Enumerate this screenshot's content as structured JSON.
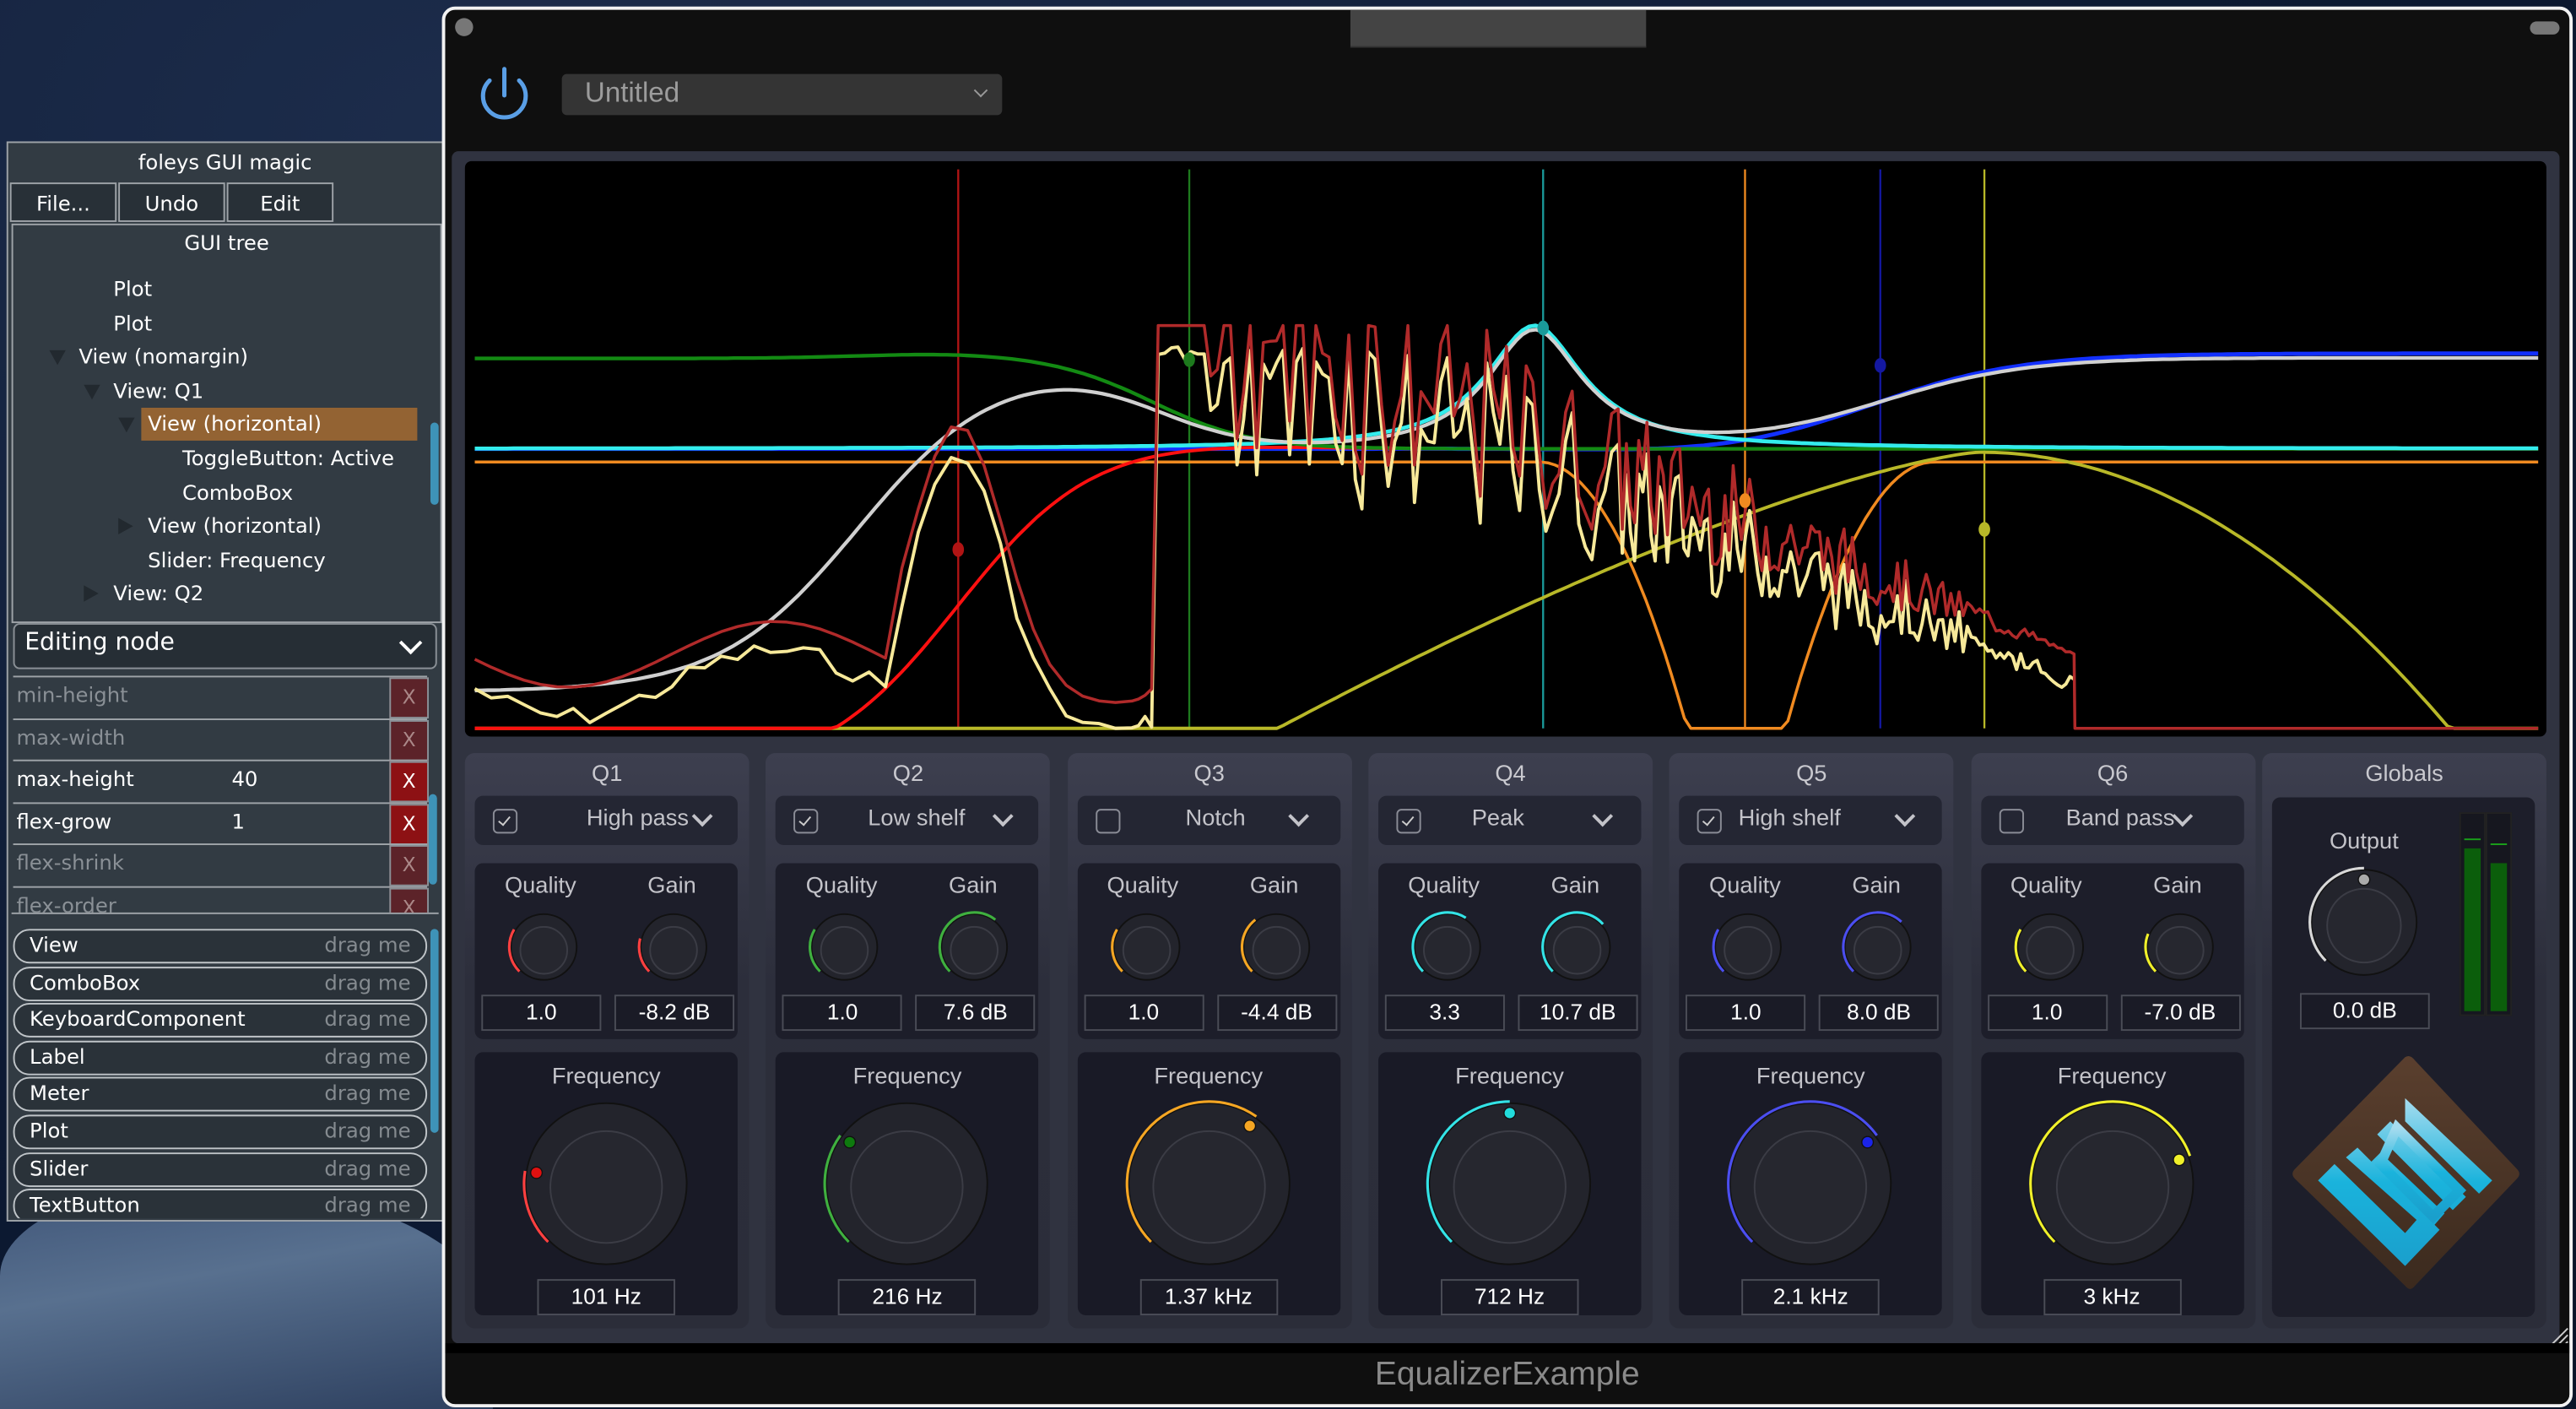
{
  "editor": {
    "title": "foleys GUI magic",
    "menu": [
      "File...",
      "Undo",
      "Edit"
    ],
    "tree_title": "GUI tree",
    "tree": [
      {
        "label": "Plot",
        "depth": 3,
        "toggle": "none"
      },
      {
        "label": "Plot",
        "depth": 3,
        "toggle": "none"
      },
      {
        "label": "View (nomargin)",
        "depth": 2,
        "toggle": "down"
      },
      {
        "label": "View: Q1",
        "depth": 3,
        "toggle": "down"
      },
      {
        "label": "View (horizontal)",
        "depth": 4,
        "toggle": "down",
        "selected": true
      },
      {
        "label": "ToggleButton: Active",
        "depth": 5,
        "toggle": "none"
      },
      {
        "label": "ComboBox",
        "depth": 5,
        "toggle": "none"
      },
      {
        "label": "View (horizontal)",
        "depth": 4,
        "toggle": "right"
      },
      {
        "label": "Slider: Frequency",
        "depth": 4,
        "toggle": "none"
      },
      {
        "label": "View: Q2",
        "depth": 3,
        "toggle": "right"
      }
    ],
    "properties_header": "Editing node",
    "properties": [
      {
        "name": "min-height",
        "value": "",
        "set": false
      },
      {
        "name": "max-width",
        "value": "",
        "set": false
      },
      {
        "name": "max-height",
        "value": "40",
        "set": true
      },
      {
        "name": "flex-grow",
        "value": "1",
        "set": true
      },
      {
        "name": "flex-shrink",
        "value": "",
        "set": false
      },
      {
        "name": "flex-order",
        "value": "",
        "set": false
      }
    ],
    "remove_label": "X",
    "palette": [
      {
        "name": "View",
        "hint": "drag me"
      },
      {
        "name": "ComboBox",
        "hint": "drag me"
      },
      {
        "name": "KeyboardComponent",
        "hint": "drag me"
      },
      {
        "name": "Label",
        "hint": "drag me"
      },
      {
        "name": "Meter",
        "hint": "drag me"
      },
      {
        "name": "Plot",
        "hint": "drag me"
      },
      {
        "name": "Slider",
        "hint": "drag me"
      },
      {
        "name": "TextButton",
        "hint": "drag me"
      }
    ]
  },
  "plugin": {
    "preset": "Untitled",
    "power_on": true,
    "footer": "EqualizerExample",
    "power_color": "#5a9fe6",
    "bands": [
      {
        "title": "Q1",
        "active": true,
        "type": "High pass",
        "quality_label": "Quality",
        "gain_label": "Gain",
        "quality": "1.0",
        "gain": "-8.2 dB",
        "frequency_label": "Frequency",
        "frequency": "101 Hz",
        "color": "#ff4040",
        "dot": "#e01010",
        "q_frac": 0.28,
        "g_frac": 0.22,
        "f_frac": 0.2
      },
      {
        "title": "Q2",
        "active": true,
        "type": "Low shelf",
        "quality_label": "Quality",
        "gain_label": "Gain",
        "quality": "1.0",
        "gain": "7.6 dB",
        "frequency_label": "Frequency",
        "frequency": "216 Hz",
        "color": "#3fb03f",
        "dot": "#0e7a0e",
        "q_frac": 0.28,
        "g_frac": 0.64,
        "f_frac": 0.3
      },
      {
        "title": "Q3",
        "active": false,
        "type": "Notch",
        "quality_label": "Quality",
        "gain_label": "Gain",
        "quality": "1.0",
        "gain": "-4.4 dB",
        "frequency_label": "Frequency",
        "frequency": "1.37 kHz",
        "color": "#f5a623",
        "dot": "#f5a623",
        "q_frac": 0.28,
        "g_frac": 0.36,
        "f_frac": 0.63
      },
      {
        "title": "Q4",
        "active": true,
        "type": "Peak",
        "quality_label": "Quality",
        "gain_label": "Gain",
        "quality": "3.3",
        "gain": "10.7 dB",
        "frequency_label": "Frequency",
        "frequency": "712 Hz",
        "color": "#33e3e6",
        "dot": "#22dcdc",
        "q_frac": 0.62,
        "g_frac": 0.68,
        "f_frac": 0.5
      },
      {
        "title": "Q5",
        "active": true,
        "type": "High shelf",
        "quality_label": "Quality",
        "gain_label": "Gain",
        "quality": "1.0",
        "gain": "8.0 dB",
        "frequency_label": "Frequency",
        "frequency": "2.1 kHz",
        "color": "#4b4ef0",
        "dot": "#1b24e8",
        "q_frac": 0.28,
        "g_frac": 0.66,
        "f_frac": 0.7
      },
      {
        "title": "Q6",
        "active": false,
        "type": "Band pass",
        "quality_label": "Quality",
        "gain_label": "Gain",
        "quality": "1.0",
        "gain": "-7.0 dB",
        "frequency_label": "Frequency",
        "frequency": "3 kHz",
        "color": "#f0f02a",
        "dot": "#f0f02a",
        "q_frac": 0.28,
        "g_frac": 0.25,
        "f_frac": 0.76
      }
    ],
    "globals": {
      "title": "Globals",
      "output_label": "Output",
      "output": "0.0 dB",
      "output_frac": 0.5,
      "meter_levels": [
        0.84,
        0.76
      ],
      "meter_peaks": [
        0.9,
        0.87
      ]
    }
  },
  "plot": {
    "band_colors": [
      "#b01414",
      "#1d7a1d",
      "#1a9a9a",
      "#f08a20",
      "#1418a0",
      "#b8b828"
    ],
    "band_marker_frac_x": [
      0.237,
      0.348,
      0.518,
      0.615,
      0.68,
      0.73
    ],
    "band_marker_frac_y": [
      0.675,
      0.345,
      0.29,
      0.59,
      0.355,
      0.64
    ]
  }
}
